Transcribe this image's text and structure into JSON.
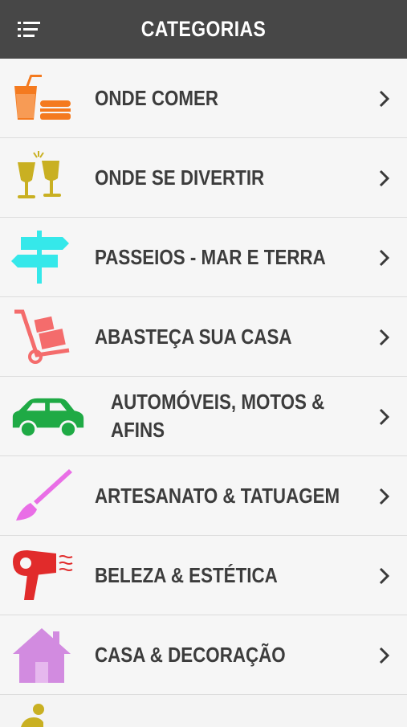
{
  "header": {
    "title": "CATEGORIAS",
    "menu_icon": "list-menu-icon"
  },
  "categories": [
    {
      "label": "ONDE COMER",
      "icon": "food-drink-icon",
      "color": "#f47a1f"
    },
    {
      "label": "ONDE SE DIVERTIR",
      "icon": "champagne-toast-icon",
      "color": "#c9b022"
    },
    {
      "label": "PASSEIOS - MAR E TERRA",
      "icon": "signpost-icon",
      "color": "#35e8ea"
    },
    {
      "label": "ABASTEÇA SUA CASA",
      "icon": "hand-truck-icon",
      "color": "#f46c6c"
    },
    {
      "label": "AUTOMÓVEIS, MOTOS & AFINS",
      "icon": "car-icon",
      "color": "#1faa45"
    },
    {
      "label": "ARTESANATO & TATUAGEM",
      "icon": "paintbrush-icon",
      "color": "#e96ee6"
    },
    {
      "label": "BELEZA & ESTÉTICA",
      "icon": "hair-dryer-icon",
      "color": "#e12b2b"
    },
    {
      "label": "CASA & DECORAÇÃO",
      "icon": "house-icon",
      "color": "#d28be0"
    }
  ],
  "partial_icon": {
    "icon": "person-icon",
    "color": "#c9b022"
  }
}
